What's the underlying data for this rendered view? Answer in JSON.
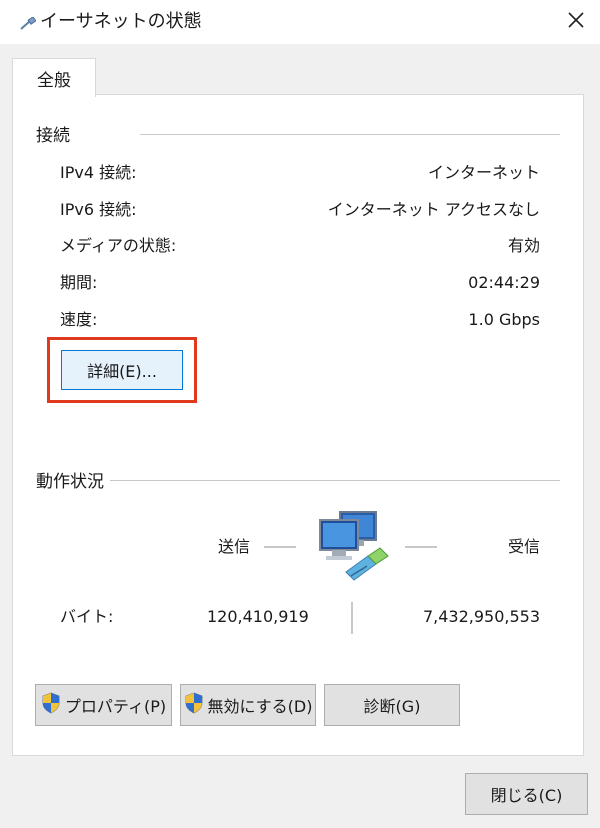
{
  "window": {
    "title": "イーサネットの状態",
    "icon": "network-cable-icon"
  },
  "tabs": [
    {
      "label": "全般"
    }
  ],
  "connection": {
    "title": "接続",
    "rows": [
      {
        "label": "IPv4 接続:",
        "value": "インターネット"
      },
      {
        "label": "IPv6 接続:",
        "value": "インターネット アクセスなし"
      },
      {
        "label": "メディアの状態:",
        "value": "有効"
      },
      {
        "label": "期間:",
        "value": "02:44:29"
      },
      {
        "label": "速度:",
        "value": "1.0 Gbps"
      }
    ],
    "details_button": "詳細(E)...",
    "highlight_color": "#e03a1e"
  },
  "activity": {
    "title": "動作状況",
    "sent_label": "送信",
    "received_label": "受信",
    "bytes_label": "バイト:",
    "bytes_sent": "120,410,919",
    "bytes_received": "7,432,950,553"
  },
  "buttons": {
    "properties": "プロパティ(P)",
    "disable": "無効にする(D)",
    "diagnose": "診断(G)",
    "close": "閉じる(C)"
  }
}
